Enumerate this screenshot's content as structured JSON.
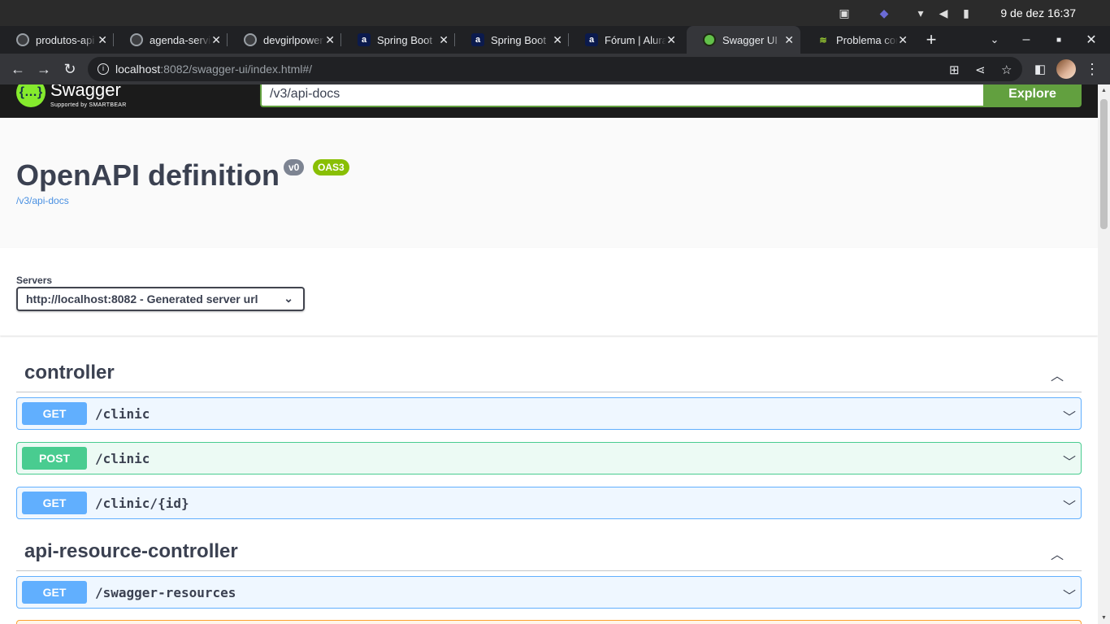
{
  "os": {
    "clock": "9 de dez  16:37"
  },
  "tabs": [
    {
      "title": "produtos-api",
      "favicon": "github-icon",
      "active": false
    },
    {
      "title": "agenda-servico",
      "favicon": "github-icon",
      "active": false
    },
    {
      "title": "devgirlpower",
      "favicon": "github-icon",
      "active": false
    },
    {
      "title": "Spring Boot",
      "favicon": "alura-icon",
      "active": false
    },
    {
      "title": "Spring Boot",
      "favicon": "alura-icon",
      "active": false
    },
    {
      "title": "Fórum | Alura",
      "favicon": "alura-icon",
      "active": false
    },
    {
      "title": "Swagger UI",
      "favicon": "swagger-icon",
      "active": true
    },
    {
      "title": "Problema com",
      "favicon": "stackoverflow-icon",
      "active": false
    }
  ],
  "address": {
    "host": "localhost",
    "rest": ":8082/swagger-ui/index.html#/"
  },
  "swagger": {
    "logo_text": "Swagger",
    "logo_sub": "Supported by SMARTBEAR",
    "url_value": "/v3/api-docs",
    "explore_label": "Explore"
  },
  "info": {
    "title": "OpenAPI definition",
    "version": "v0",
    "oas": "OAS3",
    "spec_link": "/v3/api-docs"
  },
  "servers": {
    "label": "Servers",
    "selected": "http://localhost:8082 - Generated server url"
  },
  "sections": [
    {
      "name": "controller",
      "operations": [
        {
          "method": "GET",
          "path": "/clinic"
        },
        {
          "method": "POST",
          "path": "/clinic"
        },
        {
          "method": "GET",
          "path": "/clinic/{id}"
        }
      ]
    },
    {
      "name": "api-resource-controller",
      "operations": [
        {
          "method": "GET",
          "path": "/swagger-resources"
        }
      ]
    }
  ],
  "colors": {
    "get": "#61affe",
    "post": "#49cc90",
    "put": "#fca130",
    "swagger_green": "#85ea2d",
    "explore_green": "#62a03f"
  }
}
